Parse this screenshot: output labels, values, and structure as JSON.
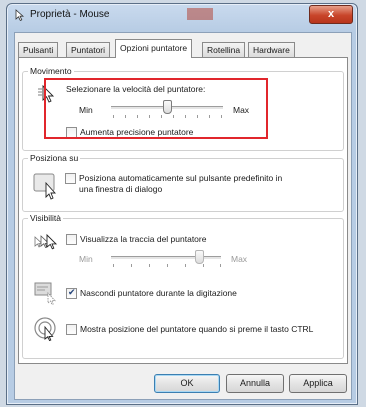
{
  "window": {
    "title": "Proprietà - Mouse",
    "close_symbol": "x"
  },
  "tabs": [
    {
      "label": "Pulsanti"
    },
    {
      "label": "Puntatori"
    },
    {
      "label": "Opzioni puntatore",
      "active": true
    },
    {
      "label": "Rotellina"
    },
    {
      "label": "Hardware"
    }
  ],
  "movement": {
    "legend": "Movimento",
    "speed_label": "Selezionare la velocità del puntatore:",
    "min": "Min",
    "max": "Max",
    "speed_level": 0.5,
    "precision_label": "Aumenta precisione puntatore",
    "precision_checked": false
  },
  "snap": {
    "legend": "Posiziona su",
    "label_line1": "Posiziona automaticamente sul pulsante predefinito in",
    "label_line2": "una finestra di dialogo",
    "checked": false
  },
  "visibility": {
    "legend": "Visibilità",
    "trails_label": "Visualizza la traccia del puntatore",
    "trails_checked": false,
    "min": "Min",
    "max": "Max",
    "trails_level": 0.8,
    "hide_label": "Nascondi puntatore durante la digitazione",
    "hide_checked": true,
    "ctrl_label": "Mostra posizione del puntatore quando si preme il tasto CTRL",
    "ctrl_checked": false
  },
  "buttons": {
    "ok": "OK",
    "cancel": "Annulla",
    "apply": "Applica"
  },
  "colors": {
    "highlight_box": "#e1262c",
    "close_button": "#c8452a"
  }
}
